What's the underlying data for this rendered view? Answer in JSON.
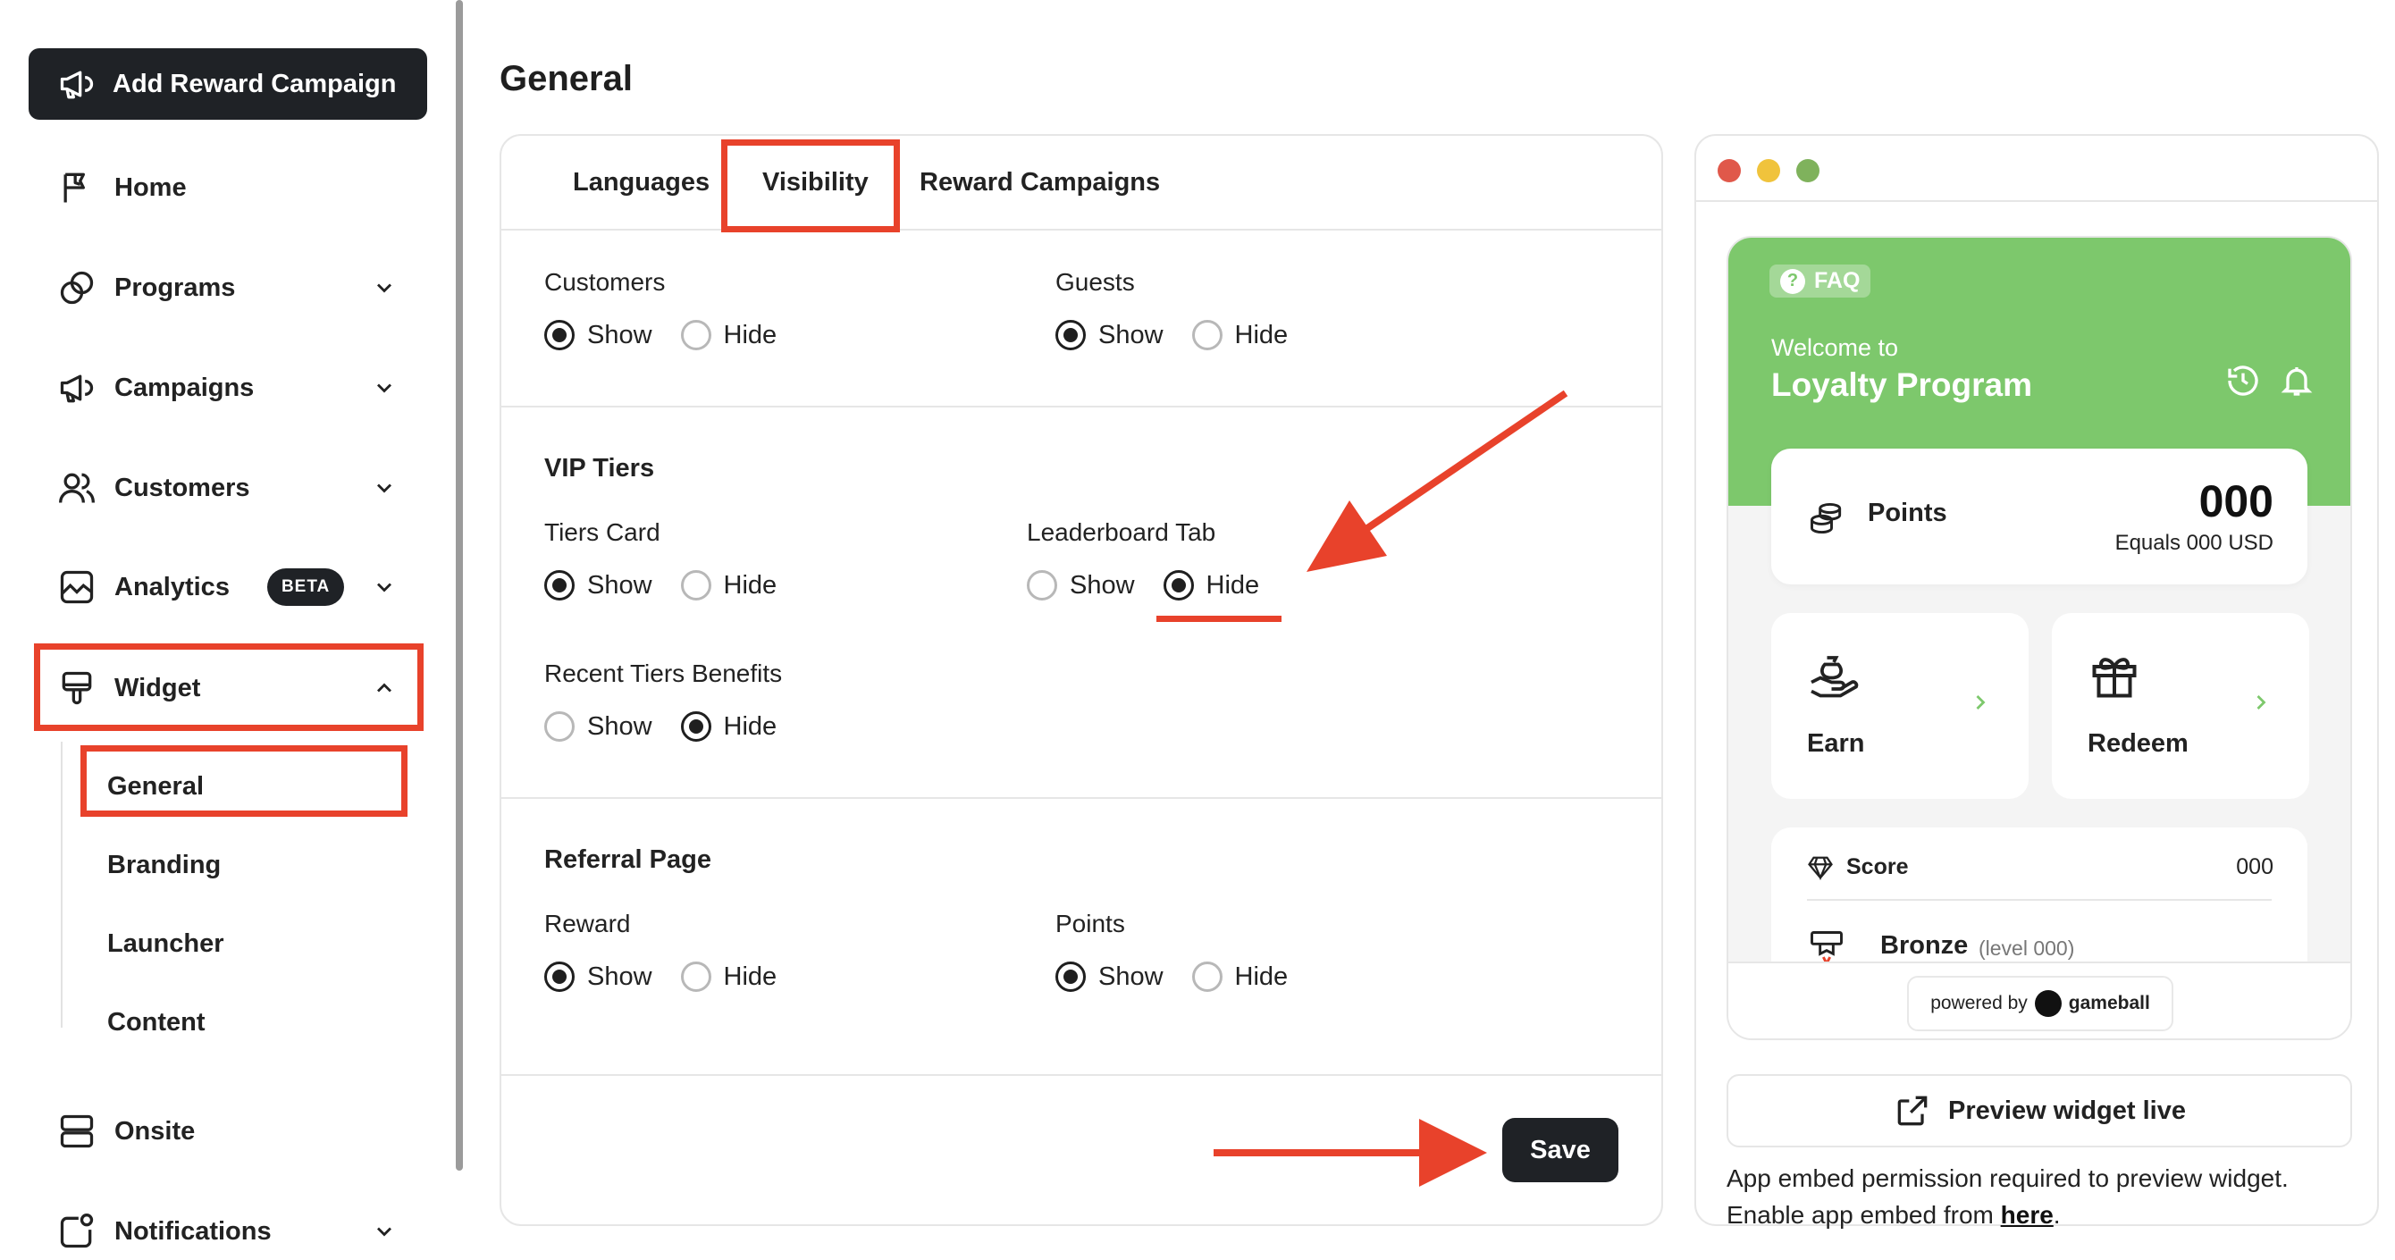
{
  "sidebar": {
    "add_button_label": "Add Reward Campaign",
    "items": [
      {
        "label": "Home",
        "icon": "flag-icon"
      },
      {
        "label": "Programs",
        "icon": "programs-icon"
      },
      {
        "label": "Campaigns",
        "icon": "megaphone-icon"
      },
      {
        "label": "Customers",
        "icon": "users-icon"
      },
      {
        "label": "Analytics",
        "icon": "chart-icon",
        "badge": "BETA"
      },
      {
        "label": "Widget",
        "icon": "widget-icon"
      },
      {
        "label": "Onsite",
        "icon": "onsite-icon"
      },
      {
        "label": "Notifications",
        "icon": "bell-square-icon"
      }
    ],
    "widget_subitems": [
      "General",
      "Branding",
      "Launcher",
      "Content"
    ]
  },
  "main": {
    "title": "General",
    "tabs": [
      "Languages",
      "Visibility",
      "Reward Campaigns"
    ],
    "active_tab": "Visibility",
    "customers": {
      "label": "Customers",
      "value": "Show"
    },
    "guests": {
      "label": "Guests",
      "value": "Show"
    },
    "vip_tiers": {
      "title": "VIP Tiers",
      "tiers_card": {
        "label": "Tiers Card",
        "value": "Show"
      },
      "leaderboard_tab": {
        "label": "Leaderboard Tab",
        "value": "Hide"
      },
      "recent_tiers_benefits": {
        "label": "Recent Tiers Benefits",
        "value": "Hide"
      }
    },
    "referral_page": {
      "title": "Referral Page",
      "reward": {
        "label": "Reward",
        "value": "Show"
      },
      "points": {
        "label": "Points",
        "value": "Show"
      }
    },
    "show_label": "Show",
    "hide_label": "Hide",
    "save_label": "Save"
  },
  "preview": {
    "faq": "FAQ",
    "welcome": "Welcome to",
    "program_name": "Loyalty Program",
    "points_label": "Points",
    "points_value": "000",
    "points_equals": "Equals 000 USD",
    "earn": "Earn",
    "redeem": "Redeem",
    "score_label": "Score",
    "score_value": "000",
    "tier_name": "Bronze",
    "tier_level": "(level 000)",
    "powered_by": "powered by",
    "brand": "gameball",
    "preview_live": "Preview widget live",
    "embed_note": "App embed permission required to preview widget. Enable app embed from ",
    "embed_link": "here",
    "embed_end": "."
  },
  "colors": {
    "accent_dark": "#1f2226",
    "widget_green": "#7dc86c",
    "annotation_red": "#e8422b",
    "dot_red": "#e0584a",
    "dot_yellow": "#f0c33c",
    "dot_green": "#7fb25c"
  }
}
